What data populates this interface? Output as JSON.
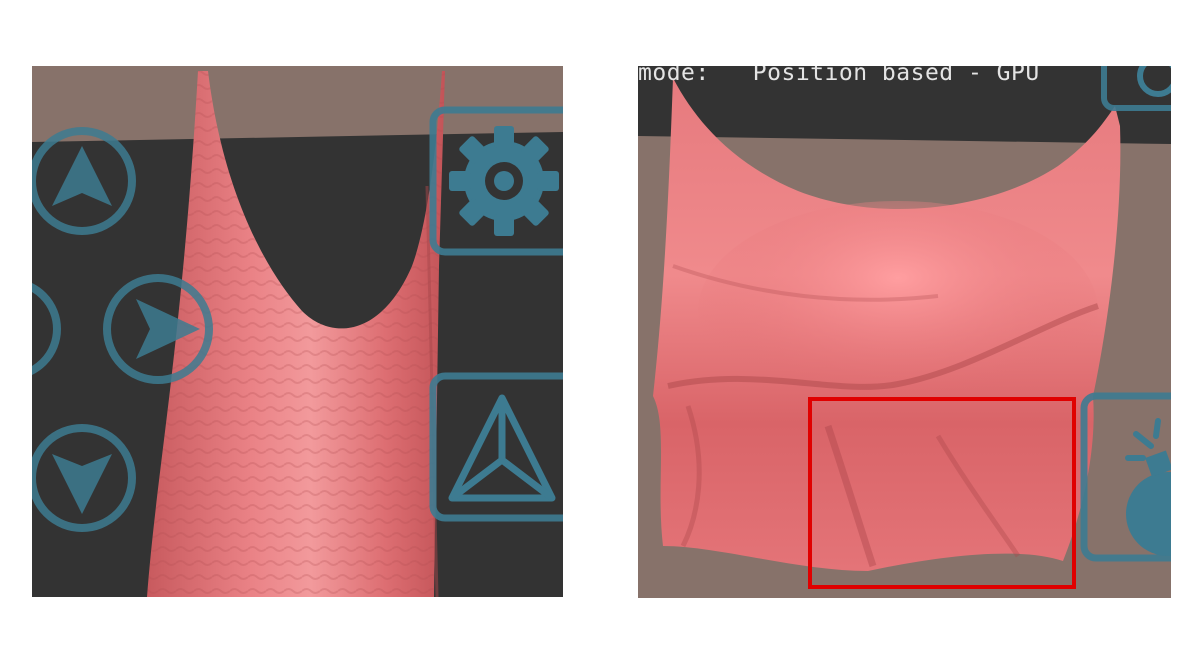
{
  "left_panel": {
    "controls": {
      "up_button": "arrow-up-icon",
      "left_button": "arrow-left-icon",
      "right_button": "arrow-right-icon",
      "down_button": "arrow-down-icon",
      "settings_button": "gear-icon",
      "mode_button": "tetrahedron-icon"
    }
  },
  "right_panel": {
    "mode_label": "mode:   Position based - GPU",
    "highlight_color": "#e00000",
    "controls": {
      "top_button": "partial-icon",
      "bomb_button": "bomb-icon"
    }
  },
  "colors": {
    "cloth": "#e8787a",
    "ui_accent": "#3d7b91",
    "ground": "#87726a",
    "background": "#333333"
  }
}
